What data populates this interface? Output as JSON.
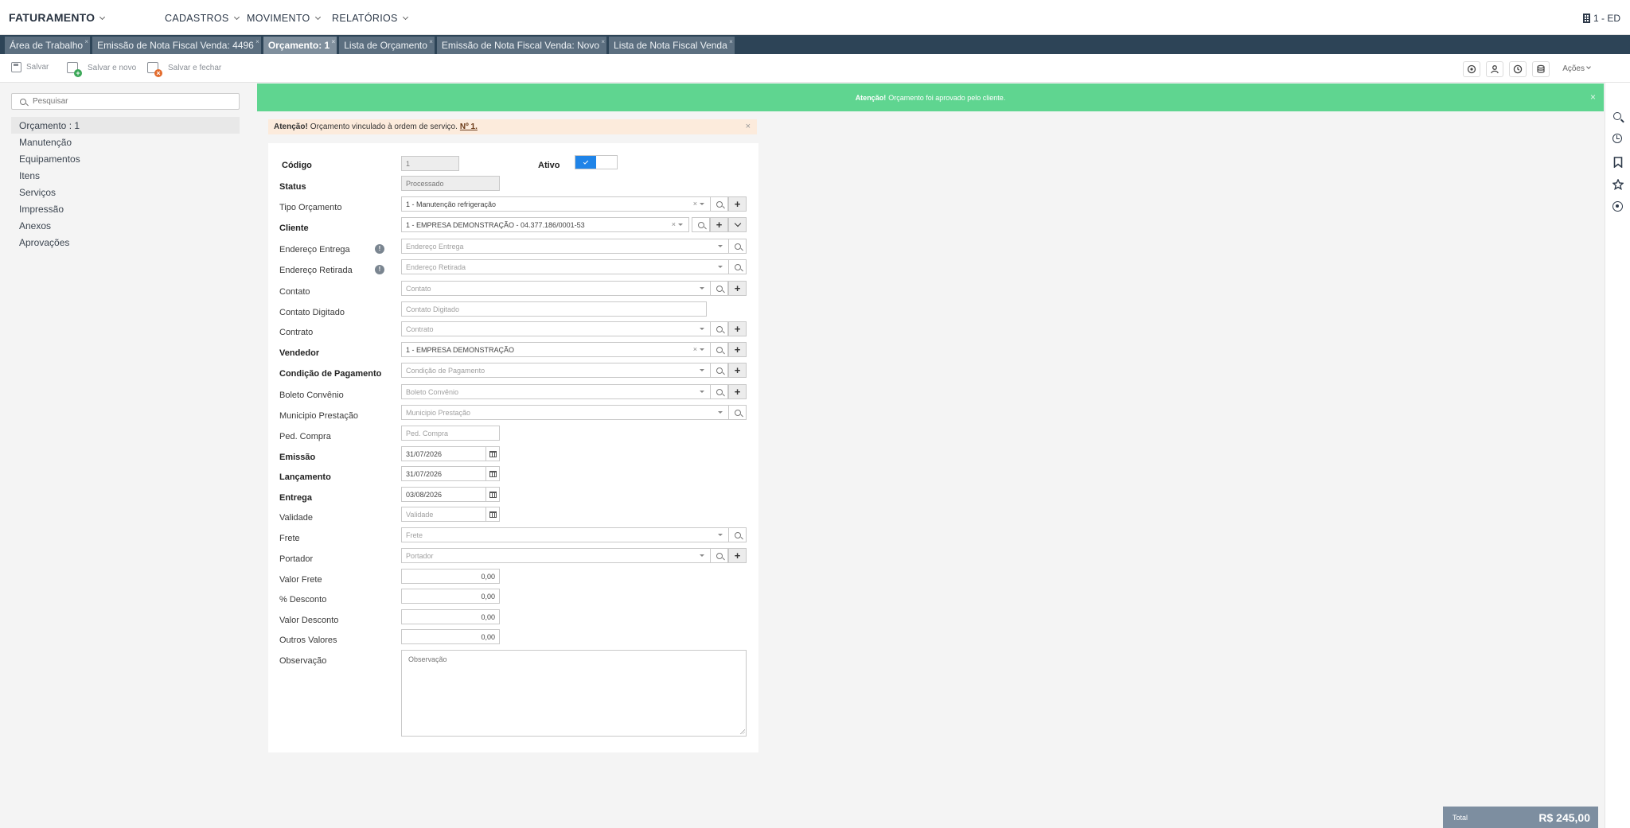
{
  "nav": {
    "brand": "FATURAMENTO",
    "menus": [
      "CADASTROS",
      "MOVIMENTO",
      "RELATÓRIOS"
    ],
    "company": "1 - ED"
  },
  "tabs": [
    {
      "label": "Área de Trabalho",
      "active": false
    },
    {
      "label": "Emissão de Nota Fiscal Venda: 4496",
      "active": false
    },
    {
      "label": "Orçamento: 1",
      "active": true
    },
    {
      "label": "Lista de Orçamento",
      "active": false
    },
    {
      "label": "Emissão de Nota Fiscal Venda: Novo",
      "active": false
    },
    {
      "label": "Lista de Nota Fiscal Venda",
      "active": false
    }
  ],
  "toolbar": {
    "save": "Salvar",
    "save_new": "Salvar e novo",
    "save_close": "Salvar e fechar",
    "actions": "Ações"
  },
  "sidebar": {
    "search_placeholder": "Pesquisar",
    "items": [
      "Orçamento : 1",
      "Manutenção",
      "Equipamentos",
      "Itens",
      "Serviços",
      "Impressão",
      "Anexos",
      "Aprovações"
    ]
  },
  "alerts": {
    "green_title": "Atenção!",
    "green_text": "Orçamento foi aprovado pelo cliente.",
    "orange_title": "Atenção!",
    "orange_text": "Orçamento vinculado à ordem de serviço.",
    "orange_link": "Nº 1."
  },
  "form": {
    "codigo": {
      "label": "Código",
      "value": "1"
    },
    "ativo": {
      "label": "Ativo",
      "checked": true
    },
    "status": {
      "label": "Status",
      "value": "Processado"
    },
    "tipo_orcamento": {
      "label": "Tipo Orçamento",
      "value": "1 - Manutenção refrigeração"
    },
    "cliente": {
      "label": "Cliente",
      "value": "1 - EMPRESA DEMONSTRAÇÃO - 04.377.186/0001-53"
    },
    "endereco_entrega": {
      "label": "Endereço Entrega",
      "placeholder": "Endereço Entrega"
    },
    "endereco_retirada": {
      "label": "Endereço Retirada",
      "placeholder": "Endereço Retirada"
    },
    "contato": {
      "label": "Contato",
      "placeholder": "Contato"
    },
    "contato_digitado": {
      "label": "Contato Digitado",
      "placeholder": "Contato Digitado"
    },
    "contrato": {
      "label": "Contrato",
      "placeholder": "Contrato"
    },
    "vendedor": {
      "label": "Vendedor",
      "value": "1 - EMPRESA DEMONSTRAÇÃO"
    },
    "condicao_pagamento": {
      "label": "Condição de Pagamento",
      "placeholder": "Condição de Pagamento"
    },
    "boleto_convenio": {
      "label": "Boleto Convênio",
      "placeholder": "Boleto Convênio"
    },
    "municipio_prestacao": {
      "label": "Municipio Prestação",
      "placeholder": "Municipio Prestação"
    },
    "ped_compra": {
      "label": "Ped. Compra",
      "placeholder": "Ped. Compra"
    },
    "emissao": {
      "label": "Emissão",
      "value": "31/07/2026"
    },
    "lancamento": {
      "label": "Lançamento",
      "value": "31/07/2026"
    },
    "entrega": {
      "label": "Entrega",
      "value": "03/08/2026"
    },
    "validade": {
      "label": "Validade",
      "placeholder": "Validade"
    },
    "frete": {
      "label": "Frete",
      "placeholder": "Frete"
    },
    "portador": {
      "label": "Portador",
      "placeholder": "Portador"
    },
    "valor_frete": {
      "label": "Valor Frete",
      "value": "0,00"
    },
    "pct_desconto": {
      "label": "% Desconto",
      "value": "0,00"
    },
    "valor_desconto": {
      "label": "Valor Desconto",
      "value": "0,00"
    },
    "outros_valores": {
      "label": "Outros Valores",
      "value": "0,00"
    },
    "observacao": {
      "label": "Observação",
      "placeholder": "Observação"
    }
  },
  "total": {
    "label": "Total",
    "value": "R$ 245,00"
  },
  "icons": {
    "clear": "×",
    "close": "×",
    "info": "!",
    "calendar": "calendar-icon",
    "search": "search-icon",
    "add": "+"
  },
  "colors": {
    "tab_strip": "#2d4457",
    "alert_green": "#5fd590",
    "alert_orange": "#fcebdc",
    "toggle_on": "#1f84e8",
    "total_bg": "#7d8ea0"
  }
}
